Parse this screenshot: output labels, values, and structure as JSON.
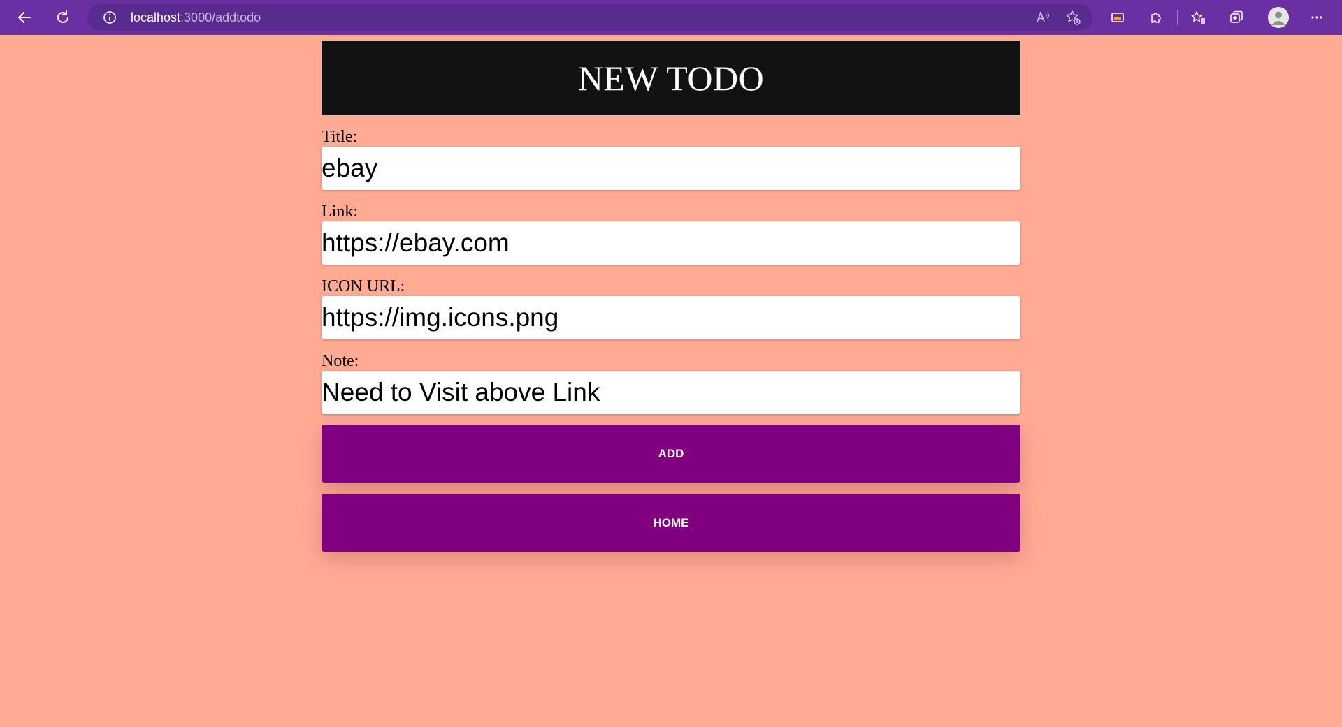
{
  "browser": {
    "url_host": "localhost",
    "url_path": ":3000/addtodo"
  },
  "page": {
    "heading": "NEW TODO",
    "fields": [
      {
        "label": "Title:",
        "value": "ebay"
      },
      {
        "label": "Link:",
        "value": "https://ebay.com"
      },
      {
        "label": "ICON URL:",
        "value": "https://img.icons.png"
      },
      {
        "label": "Note:",
        "value": "Need to Visit above Link"
      }
    ],
    "buttons": {
      "add_label": "ADD",
      "home_label": "HOME"
    }
  },
  "colors": {
    "page_background": "#ffab94",
    "browser_bar": "#6a2fa2",
    "header_background": "#121212",
    "button_background": "#800080"
  }
}
